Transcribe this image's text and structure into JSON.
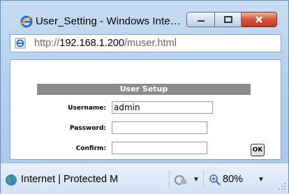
{
  "window": {
    "title": "User_Setting - Windows Inte…"
  },
  "address_bar": {
    "url_prefix": "http://",
    "url_host": "192.168.1.200",
    "url_path": "/muser.html"
  },
  "form": {
    "heading": "User Setup",
    "username_label": "Username:",
    "username_value": "admin",
    "password_label": "Password:",
    "password_value": "",
    "confirm_label": "Confirm:",
    "confirm_value": "",
    "ok_label": "OK"
  },
  "status_bar": {
    "zone_text": "Internet | Protected M",
    "zoom_text": "80%",
    "dropdown_glyph": "▼"
  }
}
